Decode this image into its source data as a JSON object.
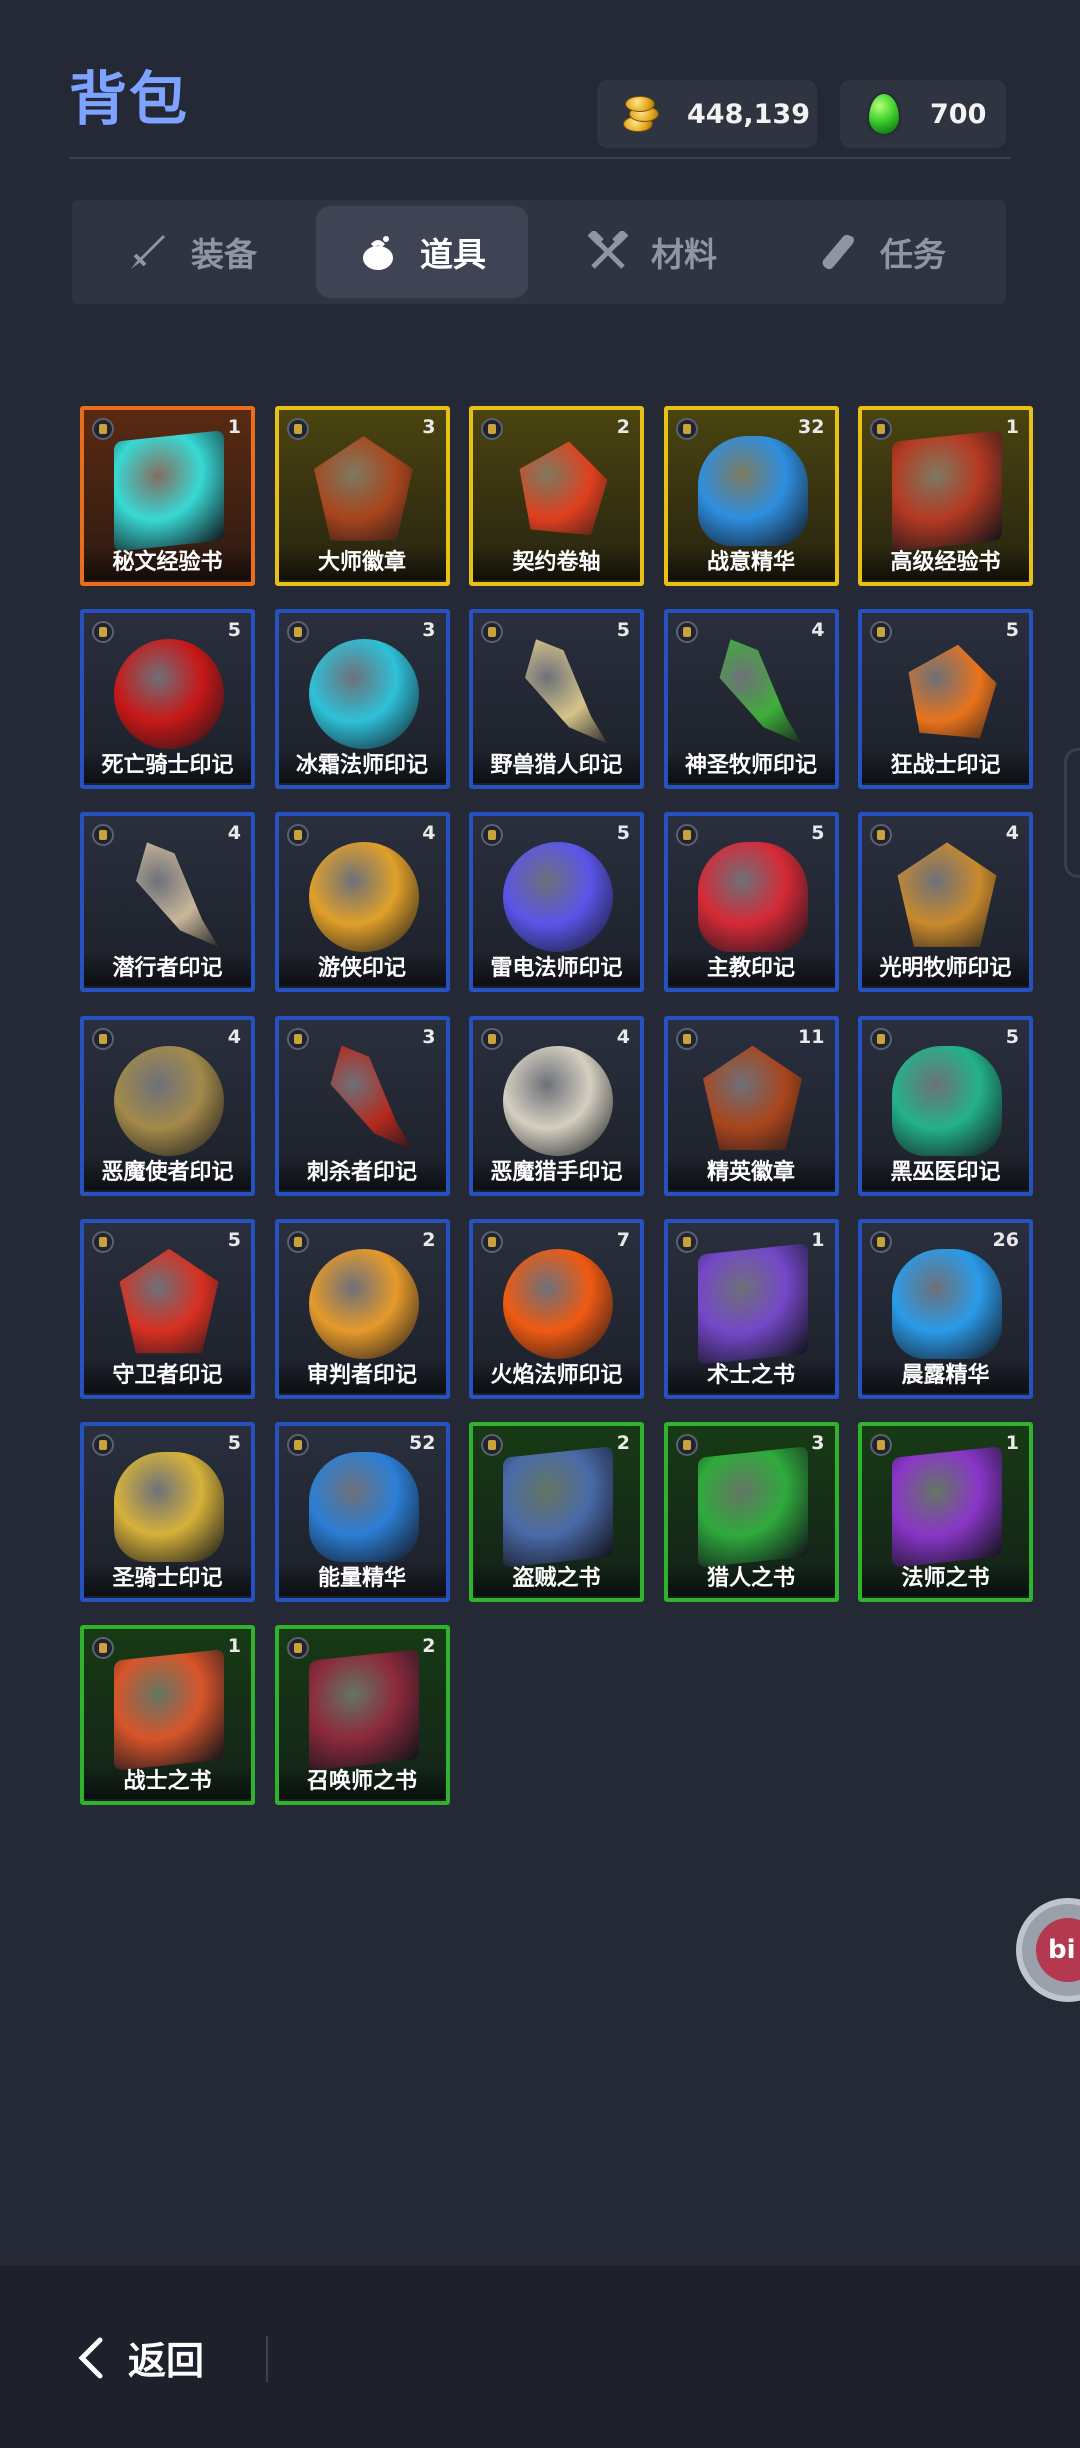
{
  "header": {
    "title": "背包",
    "gold": "448,139",
    "gems": "700"
  },
  "tabs": [
    {
      "label": "装备",
      "icon": "sword-icon",
      "active": false
    },
    {
      "label": "道具",
      "icon": "pouch-icon",
      "active": true
    },
    {
      "label": "材料",
      "icon": "crossed-hammers-icon",
      "active": false
    },
    {
      "label": "任务",
      "icon": "scroll-icon",
      "active": false
    }
  ],
  "items": [
    {
      "name": "秘文经验书",
      "count": "1",
      "rarity": "orange",
      "color": "#38d9d4"
    },
    {
      "name": "大师徽章",
      "count": "3",
      "rarity": "gold",
      "color": "#a9451c"
    },
    {
      "name": "契约卷轴",
      "count": "2",
      "rarity": "gold",
      "color": "#e0401e"
    },
    {
      "name": "战意精华",
      "count": "32",
      "rarity": "gold",
      "color": "#2e8fe0"
    },
    {
      "name": "高级经验书",
      "count": "1",
      "rarity": "gold",
      "color": "#b53a22"
    },
    {
      "name": "死亡骑士印记",
      "count": "5",
      "rarity": "blue",
      "color": "#c81818"
    },
    {
      "name": "冰霜法师印记",
      "count": "3",
      "rarity": "blue",
      "color": "#2ec1d8"
    },
    {
      "name": "野兽猎人印记",
      "count": "5",
      "rarity": "blue",
      "color": "#d6c48a"
    },
    {
      "name": "神圣牧师印记",
      "count": "4",
      "rarity": "blue",
      "color": "#3fae3a"
    },
    {
      "name": "狂战士印记",
      "count": "5",
      "rarity": "blue",
      "color": "#e8731c"
    },
    {
      "name": "潜行者印记",
      "count": "4",
      "rarity": "blue",
      "color": "#c9b79a"
    },
    {
      "name": "游侠印记",
      "count": "4",
      "rarity": "blue",
      "color": "#e0a02a"
    },
    {
      "name": "雷电法师印记",
      "count": "5",
      "rarity": "blue",
      "color": "#5a55e8"
    },
    {
      "name": "主教印记",
      "count": "5",
      "rarity": "blue",
      "color": "#d52a36"
    },
    {
      "name": "光明牧师印记",
      "count": "4",
      "rarity": "blue",
      "color": "#c98a2c"
    },
    {
      "name": "恶魔使者印记",
      "count": "4",
      "rarity": "blue",
      "color": "#a38a4a"
    },
    {
      "name": "刺杀者印记",
      "count": "3",
      "rarity": "blue",
      "color": "#b52a1e"
    },
    {
      "name": "恶魔猎手印记",
      "count": "4",
      "rarity": "blue",
      "color": "#d5cfc0"
    },
    {
      "name": "精英徽章",
      "count": "11",
      "rarity": "blue",
      "color": "#a9451c"
    },
    {
      "name": "黑巫医印记",
      "count": "5",
      "rarity": "blue",
      "color": "#23b28a"
    },
    {
      "name": "守卫者印记",
      "count": "5",
      "rarity": "blue",
      "color": "#d83020"
    },
    {
      "name": "审判者印记",
      "count": "2",
      "rarity": "blue",
      "color": "#e69a2a"
    },
    {
      "name": "火焰法师印记",
      "count": "7",
      "rarity": "blue",
      "color": "#f05a12"
    },
    {
      "name": "术士之书",
      "count": "1",
      "rarity": "blue",
      "color": "#7448c8"
    },
    {
      "name": "晨露精华",
      "count": "26",
      "rarity": "blue",
      "color": "#2b9be8"
    },
    {
      "name": "圣骑士印记",
      "count": "5",
      "rarity": "blue",
      "color": "#d6b23a"
    },
    {
      "name": "能量精华",
      "count": "52",
      "rarity": "blue",
      "color": "#2c7fd6"
    },
    {
      "name": "盗贼之书",
      "count": "2",
      "rarity": "green",
      "color": "#4a6aa8"
    },
    {
      "name": "猎人之书",
      "count": "3",
      "rarity": "green",
      "color": "#2faa3c"
    },
    {
      "name": "法师之书",
      "count": "1",
      "rarity": "green",
      "color": "#8a36c8"
    },
    {
      "name": "战士之书",
      "count": "1",
      "rarity": "green",
      "color": "#d8552a"
    },
    {
      "name": "召唤师之书",
      "count": "2",
      "rarity": "green",
      "color": "#8c2a3c"
    }
  ],
  "float_button": {
    "text": "bi"
  },
  "footer": {
    "back_label": "返回"
  }
}
